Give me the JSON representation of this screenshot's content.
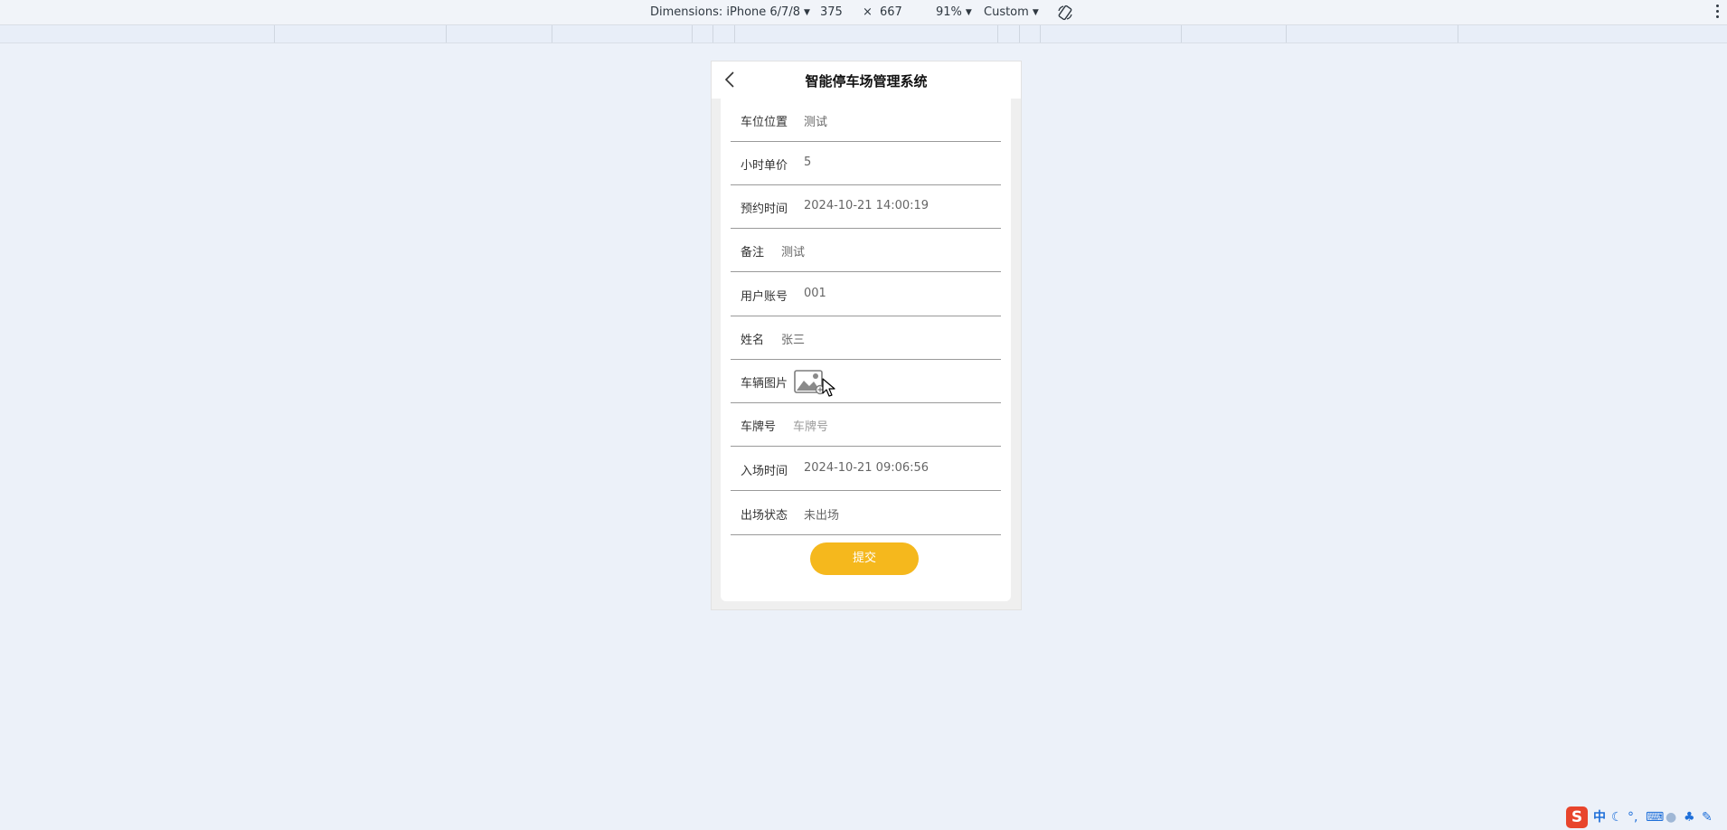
{
  "devtools": {
    "dimensions_label": "Dimensions: iPhone 6/7/8",
    "width": "375",
    "times": "×",
    "height": "667",
    "zoom": "91%",
    "throttle": "Custom"
  },
  "app": {
    "title": "智能停车场管理系统"
  },
  "form": {
    "rows": [
      {
        "label": "车位位置",
        "value": "测试"
      },
      {
        "label": "小时单价",
        "value": "5"
      },
      {
        "label": "预约时间",
        "value": "2024-10-21 14:00:19"
      },
      {
        "label": "备注",
        "value": "测试"
      },
      {
        "label": "用户账号",
        "value": "001"
      },
      {
        "label": "姓名",
        "value": "张三"
      },
      {
        "label": "车辆图片",
        "value": ""
      },
      {
        "label": "车牌号",
        "value": "车牌号"
      },
      {
        "label": "入场时间",
        "value": "2024-10-21 09:06:56"
      },
      {
        "label": "出场状态",
        "value": "未出场"
      }
    ],
    "submit_label": "提交"
  },
  "tray": {
    "ime_logo": "S",
    "ime_lang": "中"
  },
  "colors": {
    "submit": "#f5b81d",
    "background": "#ecf1f9"
  }
}
